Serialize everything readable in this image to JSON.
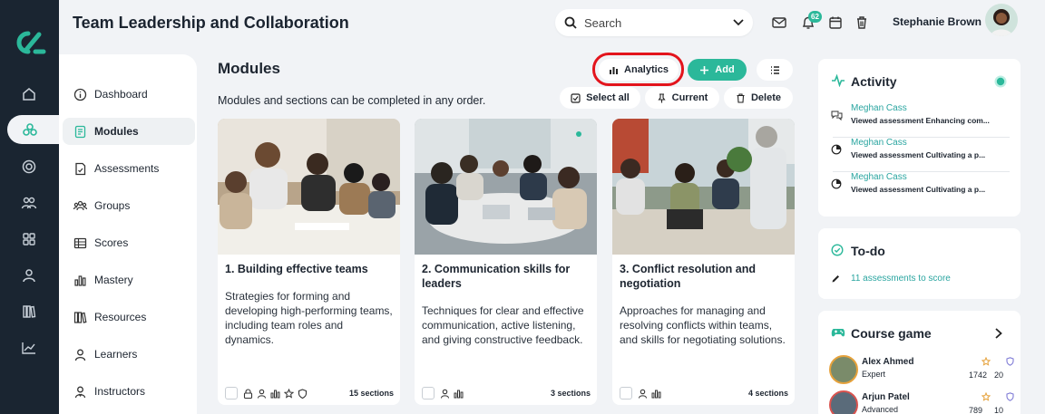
{
  "header": {
    "title": "Team Leadership and Collaboration",
    "search_placeholder": "Search",
    "notification_count": "62",
    "user_name": "Stephanie Brown"
  },
  "subnav": {
    "items": [
      {
        "label": "Dashboard",
        "icon": "info-circle-icon"
      },
      {
        "label": "Modules",
        "icon": "module-icon"
      },
      {
        "label": "Assessments",
        "icon": "assessment-icon"
      },
      {
        "label": "Groups",
        "icon": "groups-icon"
      },
      {
        "label": "Scores",
        "icon": "table-icon"
      },
      {
        "label": "Mastery",
        "icon": "bar-chart-icon"
      },
      {
        "label": "Resources",
        "icon": "books-icon"
      },
      {
        "label": "Learners",
        "icon": "user-icon"
      },
      {
        "label": "Instructors",
        "icon": "instructor-icon"
      }
    ]
  },
  "main": {
    "title": "Modules",
    "subtitle": "Modules and sections can be completed in any order.",
    "analytics_label": "Analytics",
    "add_label": "Add",
    "select_all_label": "Select all",
    "current_label": "Current",
    "delete_label": "Delete",
    "cards": [
      {
        "title": "1. Building effective teams",
        "description": "Strategies for forming and developing high-performing teams, including team roles and dynamics.",
        "sections": "15 sections"
      },
      {
        "title": "2. Communication skills for leaders",
        "description": "Techniques for clear and effective communication, active listening, and giving constructive feedback.",
        "sections": "3 sections"
      },
      {
        "title": "3. Conflict resolution and negotiation",
        "description": "Approaches for managing and resolving conflicts within teams, and skills for negotiating solutions.",
        "sections": "4 sections"
      }
    ]
  },
  "activity": {
    "title": "Activity",
    "items": [
      {
        "name": "Meghan Cass",
        "desc": "Viewed assessment Enhancing com..."
      },
      {
        "name": "Meghan Cass",
        "desc": "Viewed assessment Cultivating a p..."
      },
      {
        "name": "Meghan Cass",
        "desc": "Viewed assessment Cultivating a p..."
      }
    ]
  },
  "todo": {
    "title": "To-do",
    "link": "11 assessments to score"
  },
  "game": {
    "title": "Course game",
    "players": [
      {
        "name": "Alex Ahmed",
        "role": "Expert",
        "score": "1742",
        "badges": "20"
      },
      {
        "name": "Arjun Patel",
        "role": "Advanced",
        "score": "789",
        "badges": "10"
      }
    ]
  },
  "colors": {
    "accent": "#2bb89a",
    "rail": "#1a2531",
    "highlight": "#e3141c",
    "link": "#2aa5a0"
  }
}
